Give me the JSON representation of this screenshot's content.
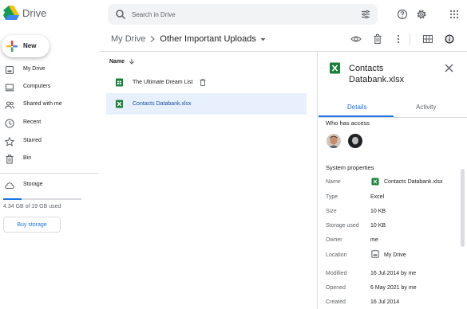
{
  "app": {
    "name": "Drive"
  },
  "search": {
    "placeholder": "Search in Drive"
  },
  "sidebar": {
    "new_label": "New",
    "items": [
      {
        "label": "My Drive",
        "icon": "my-drive-icon"
      },
      {
        "label": "Computers",
        "icon": "computer-icon"
      },
      {
        "label": "Shared with me",
        "icon": "people-icon"
      },
      {
        "label": "Recent",
        "icon": "clock-icon"
      },
      {
        "label": "Starred",
        "icon": "star-icon"
      },
      {
        "label": "Bin",
        "icon": "trash-icon"
      },
      {
        "label": "Storage",
        "icon": "cloud-icon"
      }
    ],
    "storage_text": "4.34 GB of 19 GB used",
    "storage_fraction": 0.23,
    "buy_storage_label": "Buy storage"
  },
  "breadcrumb": {
    "root": "My Drive",
    "current": "Other Important Uploads"
  },
  "file_list": {
    "column_header": "Name",
    "files": [
      {
        "name": "The Ultimate Dream List",
        "selected": false,
        "icon": "google-sheets-icon"
      },
      {
        "name": "Contacts Databank.xlsx",
        "selected": true,
        "icon": "excel-file-icon"
      }
    ]
  },
  "details": {
    "title": "Contacts Databank.xlsx",
    "tabs": [
      "Details",
      "Activity"
    ],
    "who_has_access": "Who has access",
    "system_properties": "System properties",
    "properties": [
      {
        "label": "Name",
        "value": "Contacts Databank.xlsx"
      },
      {
        "label": "Type",
        "value": "Excel"
      },
      {
        "label": "Size",
        "value": "10 KB"
      },
      {
        "label": "Storage used",
        "value": "10 KB"
      },
      {
        "label": "Owner",
        "value": "me"
      },
      {
        "label": "Location",
        "value": "My Drive"
      },
      {
        "label": "Modified",
        "value": "16 Jul 2014 by me"
      },
      {
        "label": "Opened",
        "value": "6 May 2021 by me"
      },
      {
        "label": "Created",
        "value": "16 Jul 2014"
      }
    ]
  },
  "colors": {
    "accent": "#1a73e8",
    "selected_row": "#e8f0fe",
    "sheets_green": "#188038"
  }
}
